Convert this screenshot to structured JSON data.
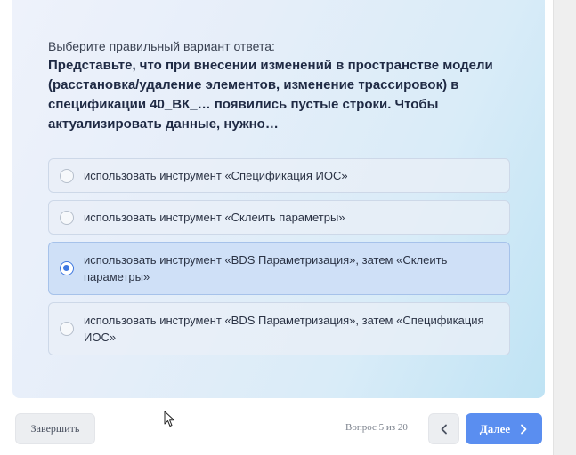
{
  "quiz": {
    "prompt": "Выберите правильный вариант ответа:",
    "question": "Представьте, что при внесении изменений в пространстве модели (расстановка/удаление элементов, изменение трассировок) в спецификации 40_ВК_… появились пустые строки. Чтобы актуализировать данные, нужно…",
    "options": [
      {
        "label": "использовать инструмент «Спецификация ИОС»",
        "selected": false
      },
      {
        "label": "использовать инструмент «Склеить параметры»",
        "selected": false
      },
      {
        "label": "использовать инструмент «BDS Параметризация», затем «Склеить параметры»",
        "selected": true
      },
      {
        "label": "использовать инструмент «BDS Параметризация», затем «Спецификация ИОС»",
        "selected": false
      }
    ]
  },
  "footer": {
    "finish_label": "Завершить",
    "counter": "Вопрос 5 из 20",
    "next_label": "Далее"
  },
  "icons": {
    "prev": "chevron-left-icon",
    "next": "chevron-right-icon",
    "cursor": "mouse-pointer-icon"
  },
  "colors": {
    "accent": "#5a8ef0",
    "selected_option": "#cfe0f7",
    "radio_selected": "#3f78e0"
  }
}
